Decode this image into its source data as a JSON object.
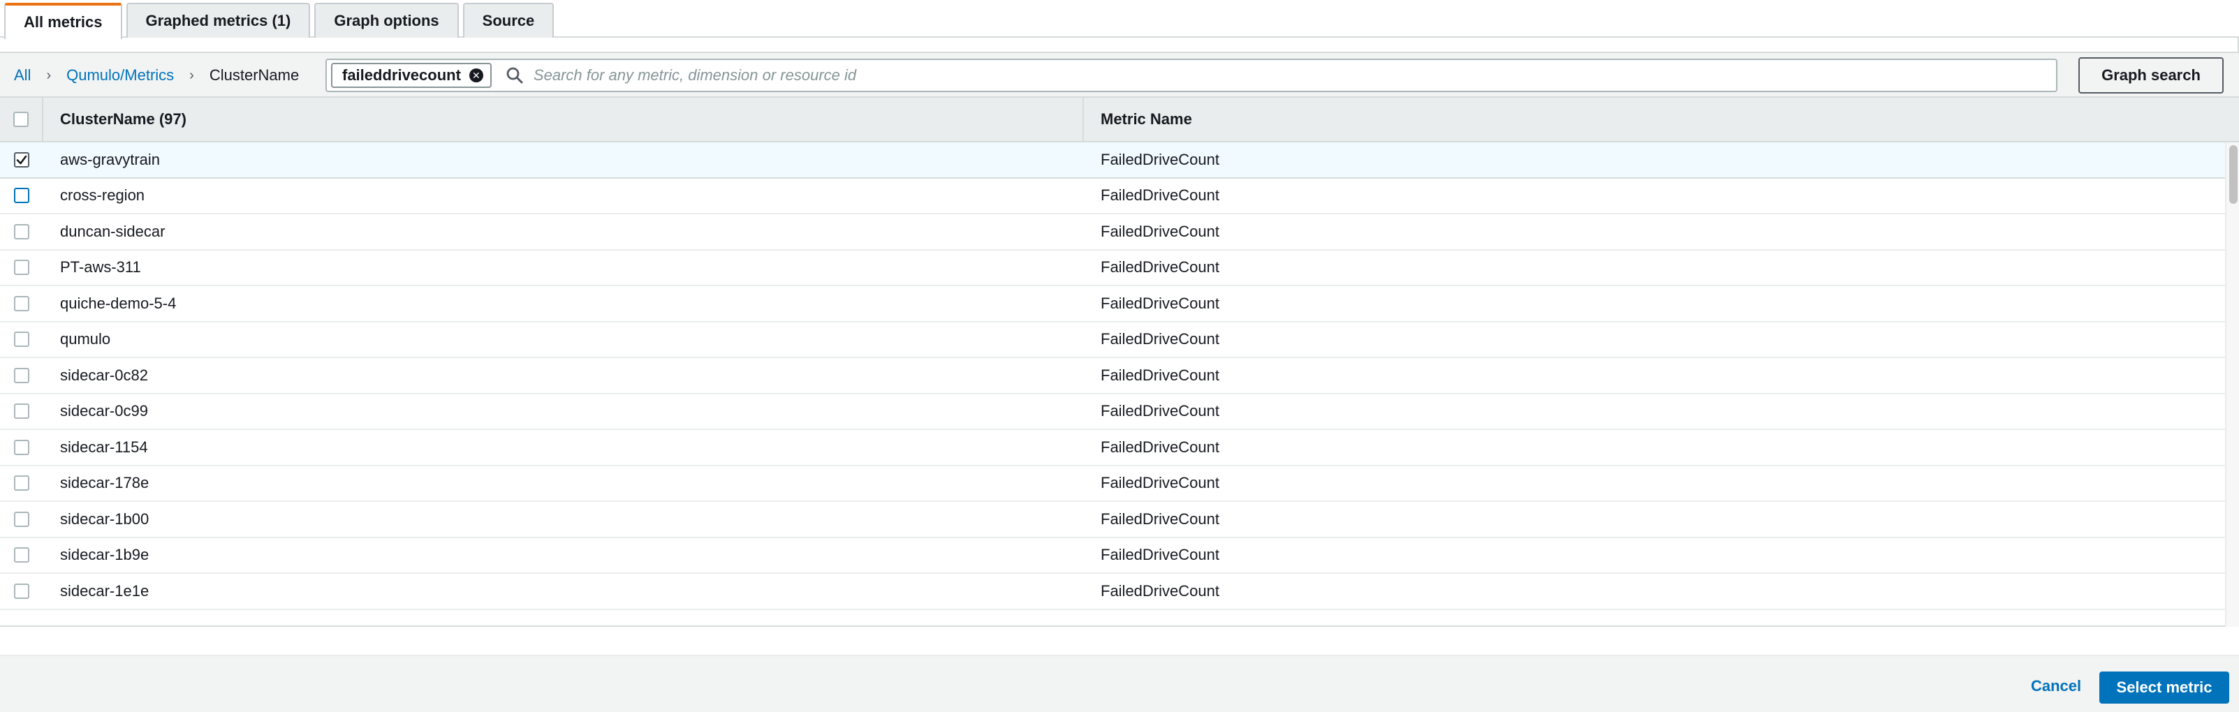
{
  "tabs": [
    {
      "label": "All metrics",
      "active": true
    },
    {
      "label": "Graphed metrics (1)",
      "active": false
    },
    {
      "label": "Graph options",
      "active": false
    },
    {
      "label": "Source",
      "active": false
    }
  ],
  "breadcrumb": {
    "all": "All",
    "namespace": "Qumulo/Metrics",
    "dimension": "ClusterName"
  },
  "search": {
    "token": "faileddrivecount",
    "placeholder": "Search for any metric, dimension or resource id",
    "graph_search_label": "Graph search"
  },
  "table": {
    "col_name": "ClusterName (97)",
    "col_metric": "Metric Name",
    "rows": [
      {
        "name": "aws-gravytrain",
        "metric": "FailedDriveCount",
        "checked": true
      },
      {
        "name": "cross-region",
        "metric": "FailedDriveCount",
        "checked": false
      },
      {
        "name": "duncan-sidecar",
        "metric": "FailedDriveCount",
        "checked": false
      },
      {
        "name": "PT-aws-311",
        "metric": "FailedDriveCount",
        "checked": false
      },
      {
        "name": "quiche-demo-5-4",
        "metric": "FailedDriveCount",
        "checked": false
      },
      {
        "name": "qumulo",
        "metric": "FailedDriveCount",
        "checked": false
      },
      {
        "name": "sidecar-0c82",
        "metric": "FailedDriveCount",
        "checked": false
      },
      {
        "name": "sidecar-0c99",
        "metric": "FailedDriveCount",
        "checked": false
      },
      {
        "name": "sidecar-1154",
        "metric": "FailedDriveCount",
        "checked": false
      },
      {
        "name": "sidecar-178e",
        "metric": "FailedDriveCount",
        "checked": false
      },
      {
        "name": "sidecar-1b00",
        "metric": "FailedDriveCount",
        "checked": false
      },
      {
        "name": "sidecar-1b9e",
        "metric": "FailedDriveCount",
        "checked": false
      },
      {
        "name": "sidecar-1e1e",
        "metric": "FailedDriveCount",
        "checked": false
      }
    ]
  },
  "footer": {
    "cancel_label": "Cancel",
    "select_label": "Select metric"
  },
  "colors": {
    "accent": "#0073bb",
    "active_tab": "#ec7211",
    "selected_row": "#f1faff"
  }
}
